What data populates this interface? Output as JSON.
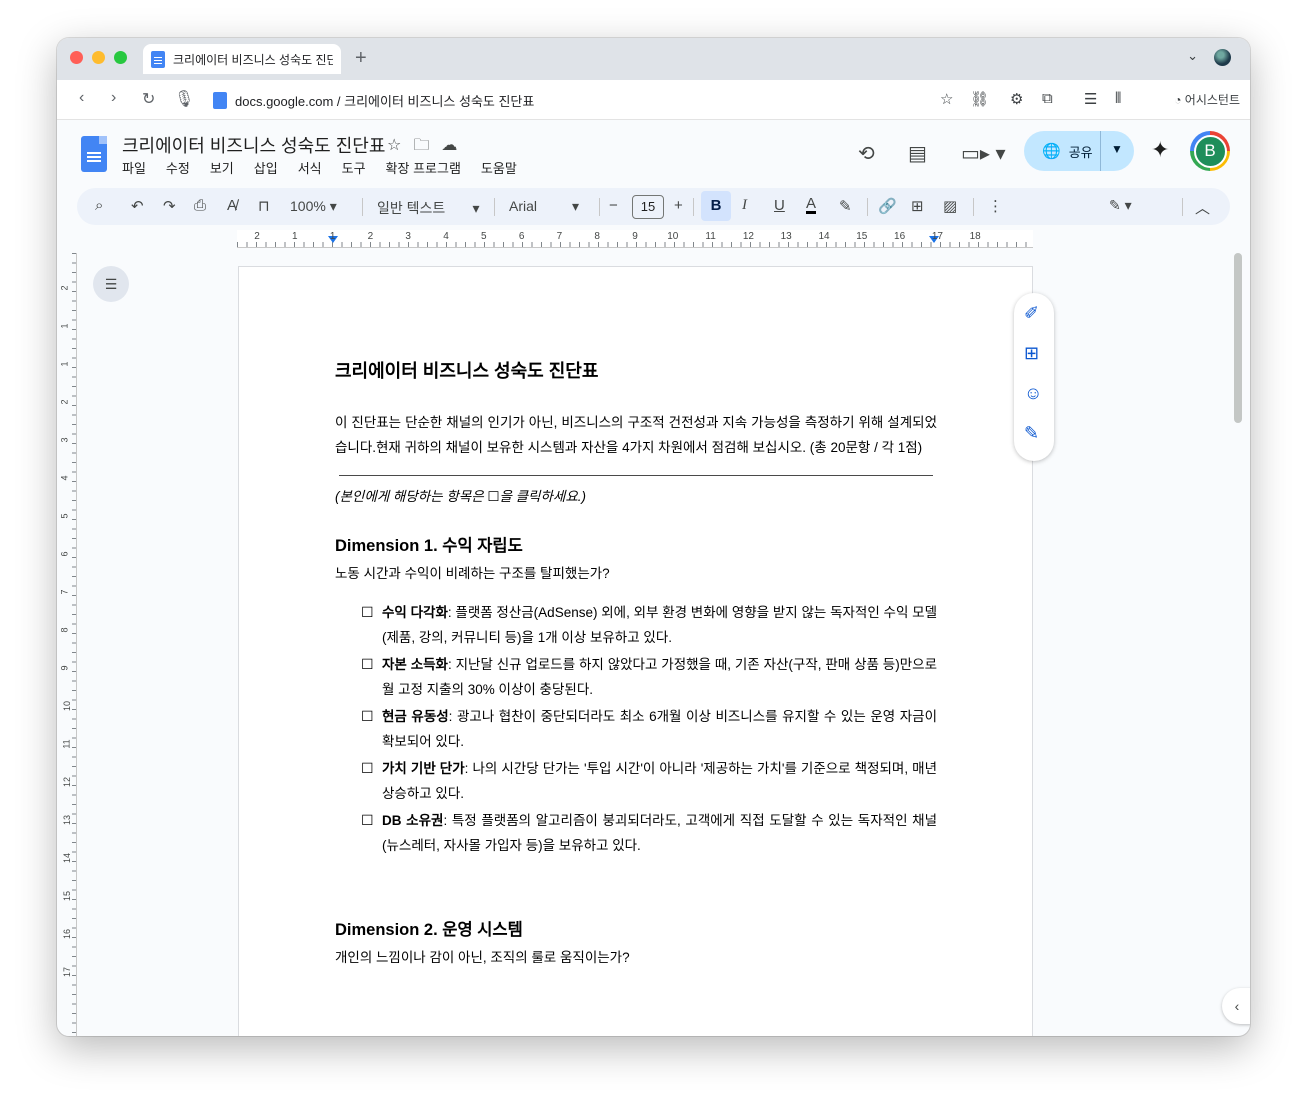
{
  "browser": {
    "tab_title": "크리에이터 비즈니스 성숙도 진단표",
    "new_tab": "+",
    "tab_dropdown": "⌄",
    "url": "docs.google.com / 크리에이터 비즈니스 성숙도 진단표",
    "assistant_label": "어시스턴트"
  },
  "docs": {
    "title": "크리에이터 비즈니스 성숙도 진단표",
    "menus": [
      "파일",
      "수정",
      "보기",
      "삽입",
      "서식",
      "도구",
      "확장 프로그램",
      "도움말"
    ],
    "share_label": "공유",
    "avatar_initial": "B"
  },
  "toolbar": {
    "zoom": "100%",
    "style": "일반 텍스트",
    "font": "Arial",
    "font_size": "15",
    "bold": "B",
    "italic": "I",
    "underline": "U",
    "text_color": "A"
  },
  "ruler": {
    "numbers": [
      "2",
      "1",
      "1",
      "2",
      "3",
      "4",
      "5",
      "6",
      "7",
      "8",
      "9",
      "10",
      "11",
      "12",
      "13",
      "14",
      "15",
      "16",
      "17",
      "18"
    ],
    "vertical_numbers": [
      "2",
      "1",
      "1",
      "2",
      "3",
      "4",
      "5",
      "6",
      "7",
      "8",
      "9",
      "10",
      "11",
      "12",
      "13",
      "14",
      "15",
      "16",
      "17"
    ]
  },
  "document": {
    "heading": "크리에이터 비즈니스 성숙도 진단표",
    "intro": "이 진단표는 단순한 채널의 인기가 아닌, 비즈니스의 구조적 건전성과 지속 가능성을 측정하기 위해 설계되었습니다.현재 귀하의 채널이 보유한 시스템과 자산을 4가지 차원에서 점검해 보십시오. (총 20문항 / 각 1점)",
    "note": "(본인에게 해당하는 항목은 ☐을 클릭하세요.)",
    "dimension1": {
      "title": "Dimension 1. 수익 자립도",
      "subtitle": "노동 시간과 수익이 비례하는 구조를 탈피했는가?",
      "items": [
        {
          "term": "수익 다각화",
          "text": ": 플랫폼 정산금(AdSense) 외에, 외부 환경 변화에 영향을 받지 않는 독자적인 수익 모델(제품, 강의, 커뮤니티 등)을 1개 이상 보유하고 있다."
        },
        {
          "term": "자본 소득화",
          "text": ": 지난달 신규 업로드를 하지 않았다고 가정했을 때, 기존 자산(구작, 판매 상품 등)만으로 월 고정 지출의 30% 이상이 충당된다."
        },
        {
          "term": "현금 유동성",
          "text": ": 광고나 협찬이 중단되더라도 최소 6개월 이상 비즈니스를 유지할 수 있는 운영 자금이 확보되어 있다."
        },
        {
          "term": "가치 기반 단가",
          "text": ": 나의 시간당 단가는 '투입 시간'이 아니라 '제공하는 가치'를 기준으로 책정되며, 매년 상승하고 있다."
        },
        {
          "term": "DB 소유권",
          "text": ": 특정 플랫폼의 알고리즘이 붕괴되더라도, 고객에게 직접 도달할 수 있는 독자적인 채널(뉴스레터, 자사몰 가입자 등)을 보유하고 있다."
        }
      ]
    },
    "dimension2": {
      "title": "Dimension 2. 운영 시스템",
      "subtitle": "개인의 느낌이나 감이 아닌, 조직의 룰로 움직이는가?"
    },
    "checkbox_glyph": "☐"
  },
  "colors": {
    "accent": "#1a73e8",
    "share_bg": "#c2e7ff",
    "bold_active_bg": "#d3e3fd",
    "toolbar_bg": "#edf2fa"
  }
}
